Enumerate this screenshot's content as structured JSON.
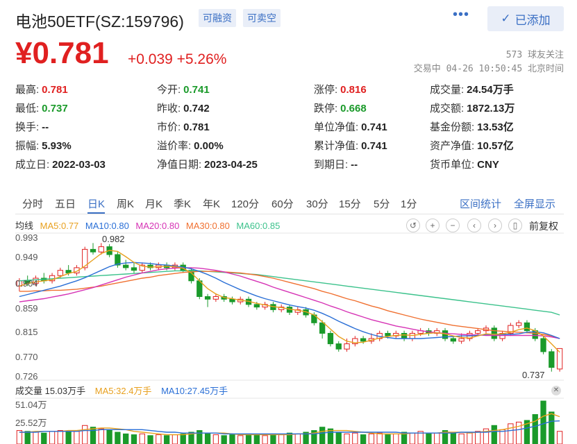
{
  "header": {
    "title": "电池50ETF(SZ:159796)",
    "tag_margin": "可融资",
    "tag_short": "可卖空",
    "more_icon": "more-dots-icon",
    "added_label": "已添加"
  },
  "quote": {
    "price": "¥0.781",
    "change": "+0.039 +5.26%",
    "followers": "573 球友关注",
    "status": "交易中 04-26 10:50:45 北京时间"
  },
  "stats": [
    [
      {
        "label": "最高:",
        "value": "0.781",
        "tone": "red"
      },
      {
        "label": "今开:",
        "value": "0.741",
        "tone": "green"
      },
      {
        "label": "涨停:",
        "value": "0.816",
        "tone": "red"
      },
      {
        "label": "成交量:",
        "value": "24.54万手",
        "tone": ""
      }
    ],
    [
      {
        "label": "最低:",
        "value": "0.737",
        "tone": "green"
      },
      {
        "label": "昨收:",
        "value": "0.742",
        "tone": ""
      },
      {
        "label": "跌停:",
        "value": "0.668",
        "tone": "green"
      },
      {
        "label": "成交额:",
        "value": "1872.13万",
        "tone": ""
      }
    ],
    [
      {
        "label": "换手:",
        "value": "--",
        "tone": ""
      },
      {
        "label": "市价:",
        "value": "0.781",
        "tone": ""
      },
      {
        "label": "单位净值:",
        "value": "0.741",
        "tone": ""
      },
      {
        "label": "基金份额:",
        "value": "13.53亿",
        "tone": ""
      }
    ],
    [
      {
        "label": "振幅:",
        "value": "5.93%",
        "tone": ""
      },
      {
        "label": "溢价率:",
        "value": "0.00%",
        "tone": ""
      },
      {
        "label": "累计净值:",
        "value": "0.741",
        "tone": ""
      },
      {
        "label": "资产净值:",
        "value": "10.57亿",
        "tone": ""
      }
    ],
    [
      {
        "label": "成立日:",
        "value": "2022-03-03",
        "tone": ""
      },
      {
        "label": "净值日期:",
        "value": "2023-04-25",
        "tone": ""
      },
      {
        "label": "到期日:",
        "value": "--",
        "tone": ""
      },
      {
        "label": "货币单位:",
        "value": "CNY",
        "tone": ""
      }
    ]
  ],
  "periods": [
    "分时",
    "五日",
    "日K",
    "周K",
    "月K",
    "季K",
    "年K",
    "120分",
    "60分",
    "30分",
    "15分",
    "5分",
    "1分"
  ],
  "active_period": "日K",
  "links": {
    "range_stats": "区间统计",
    "fullscreen": "全屏显示"
  },
  "chart_legend": {
    "prefix": "均线",
    "ma5": "MA5:0.77",
    "ma10": "MA10:0.80",
    "ma20": "MA20:0.80",
    "ma30": "MA30:0.80",
    "ma60": "MA60:0.85",
    "adjust": "前复权"
  },
  "colors": {
    "up": "#e02020",
    "down": "#1a9a2a",
    "ma5": "#e8a01e",
    "ma10": "#2a6fd6",
    "ma20": "#d633b5",
    "ma30": "#f07030",
    "ma60": "#3cc28c",
    "accent": "#3a6fc4"
  },
  "controls": [
    "undo-icon",
    "zoom-in-icon",
    "zoom-out-icon",
    "prev-icon",
    "next-icon",
    "candle-icon"
  ],
  "volume_legend": {
    "vol": "成交量 15.03万手",
    "ma5": "MA5:32.4万手",
    "ma10": "MA10:27.45万手"
  },
  "chart_data": {
    "type": "candlestick",
    "y_ticks": [
      "0.993",
      "0.949",
      "0.904",
      "0.859",
      "0.815",
      "0.770",
      "0.726"
    ],
    "ylim": [
      0.726,
      0.993
    ],
    "annotations": {
      "high": "0.982",
      "low": "0.737"
    },
    "vol_ticks": [
      "51.04万",
      "25.52万"
    ],
    "vol_max": 51.04,
    "candles": [
      [
        0.9,
        0.91,
        0.915,
        0.89
      ],
      [
        0.91,
        0.905,
        0.92,
        0.9
      ],
      [
        0.905,
        0.915,
        0.92,
        0.9
      ],
      [
        0.915,
        0.91,
        0.925,
        0.905
      ],
      [
        0.91,
        0.92,
        0.925,
        0.905
      ],
      [
        0.92,
        0.93,
        0.935,
        0.915
      ],
      [
        0.93,
        0.925,
        0.94,
        0.92
      ],
      [
        0.925,
        0.935,
        0.94,
        0.92
      ],
      [
        0.935,
        0.97,
        0.975,
        0.93
      ],
      [
        0.97,
        0.965,
        0.982,
        0.96
      ],
      [
        0.965,
        0.975,
        0.982,
        0.96
      ],
      [
        0.975,
        0.96,
        0.98,
        0.955
      ],
      [
        0.96,
        0.94,
        0.965,
        0.935
      ],
      [
        0.94,
        0.935,
        0.95,
        0.93
      ],
      [
        0.935,
        0.93,
        0.945,
        0.925
      ],
      [
        0.93,
        0.94,
        0.945,
        0.925
      ],
      [
        0.94,
        0.935,
        0.945,
        0.93
      ],
      [
        0.935,
        0.94,
        0.945,
        0.93
      ],
      [
        0.94,
        0.935,
        0.945,
        0.93
      ],
      [
        0.935,
        0.94,
        0.945,
        0.93
      ],
      [
        0.94,
        0.93,
        0.945,
        0.925
      ],
      [
        0.93,
        0.91,
        0.935,
        0.905
      ],
      [
        0.91,
        0.88,
        0.915,
        0.875
      ],
      [
        0.88,
        0.875,
        0.885,
        0.86
      ],
      [
        0.875,
        0.88,
        0.885,
        0.87
      ],
      [
        0.88,
        0.875,
        0.885,
        0.87
      ],
      [
        0.875,
        0.87,
        0.88,
        0.865
      ],
      [
        0.87,
        0.875,
        0.88,
        0.865
      ],
      [
        0.875,
        0.865,
        0.88,
        0.86
      ],
      [
        0.865,
        0.86,
        0.87,
        0.855
      ],
      [
        0.86,
        0.865,
        0.87,
        0.855
      ],
      [
        0.865,
        0.855,
        0.87,
        0.85
      ],
      [
        0.855,
        0.86,
        0.865,
        0.85
      ],
      [
        0.86,
        0.85,
        0.865,
        0.845
      ],
      [
        0.85,
        0.855,
        0.86,
        0.845
      ],
      [
        0.855,
        0.845,
        0.86,
        0.84
      ],
      [
        0.845,
        0.83,
        0.85,
        0.825
      ],
      [
        0.83,
        0.81,
        0.835,
        0.8
      ],
      [
        0.81,
        0.79,
        0.815,
        0.785
      ],
      [
        0.79,
        0.78,
        0.795,
        0.775
      ],
      [
        0.78,
        0.79,
        0.8,
        0.775
      ],
      [
        0.79,
        0.8,
        0.805,
        0.785
      ],
      [
        0.8,
        0.795,
        0.805,
        0.79
      ],
      [
        0.795,
        0.8,
        0.81,
        0.79
      ],
      [
        0.8,
        0.81,
        0.815,
        0.795
      ],
      [
        0.81,
        0.805,
        0.815,
        0.8
      ],
      [
        0.805,
        0.81,
        0.815,
        0.8
      ],
      [
        0.81,
        0.8,
        0.815,
        0.795
      ],
      [
        0.8,
        0.81,
        0.815,
        0.795
      ],
      [
        0.81,
        0.815,
        0.82,
        0.805
      ],
      [
        0.815,
        0.81,
        0.82,
        0.805
      ],
      [
        0.81,
        0.815,
        0.82,
        0.805
      ],
      [
        0.815,
        0.8,
        0.82,
        0.795
      ],
      [
        0.8,
        0.795,
        0.805,
        0.79
      ],
      [
        0.795,
        0.8,
        0.81,
        0.79
      ],
      [
        0.8,
        0.81,
        0.815,
        0.795
      ],
      [
        0.81,
        0.815,
        0.82,
        0.805
      ],
      [
        0.815,
        0.82,
        0.825,
        0.81
      ],
      [
        0.82,
        0.8,
        0.825,
        0.795
      ],
      [
        0.8,
        0.81,
        0.815,
        0.795
      ],
      [
        0.81,
        0.825,
        0.83,
        0.805
      ],
      [
        0.825,
        0.83,
        0.835,
        0.82
      ],
      [
        0.83,
        0.815,
        0.835,
        0.81
      ],
      [
        0.815,
        0.8,
        0.82,
        0.795
      ],
      [
        0.8,
        0.775,
        0.805,
        0.77
      ],
      [
        0.775,
        0.745,
        0.78,
        0.737
      ],
      [
        0.742,
        0.781,
        0.781,
        0.737
      ]
    ],
    "volume": [
      16,
      15,
      14,
      13,
      15,
      16,
      14,
      15,
      22,
      20,
      18,
      17,
      14,
      12,
      11,
      12,
      10,
      11,
      10,
      11,
      12,
      14,
      16,
      13,
      11,
      10,
      11,
      10,
      12,
      11,
      10,
      12,
      11,
      13,
      12,
      14,
      16,
      20,
      18,
      14,
      12,
      13,
      11,
      12,
      13,
      11,
      12,
      14,
      13,
      15,
      12,
      13,
      16,
      14,
      12,
      13,
      15,
      18,
      22,
      17,
      24,
      26,
      28,
      35,
      51,
      38,
      15.03
    ],
    "ma5": [
      0.9,
      0.905,
      0.908,
      0.91,
      0.912,
      0.918,
      0.924,
      0.928,
      0.938,
      0.95,
      0.962,
      0.968,
      0.966,
      0.956,
      0.945,
      0.938,
      0.936,
      0.937,
      0.938,
      0.937,
      0.934,
      0.925,
      0.91,
      0.895,
      0.885,
      0.878,
      0.876,
      0.873,
      0.871,
      0.867,
      0.864,
      0.861,
      0.859,
      0.856,
      0.854,
      0.851,
      0.845,
      0.832,
      0.818,
      0.804,
      0.795,
      0.792,
      0.793,
      0.797,
      0.801,
      0.804,
      0.806,
      0.807,
      0.806,
      0.808,
      0.81,
      0.811,
      0.809,
      0.805,
      0.802,
      0.801,
      0.805,
      0.809,
      0.808,
      0.809,
      0.812,
      0.817,
      0.82,
      0.815,
      0.805,
      0.79,
      0.774
    ],
    "ma10": [
      0.88,
      0.884,
      0.888,
      0.892,
      0.896,
      0.9,
      0.905,
      0.91,
      0.916,
      0.923,
      0.93,
      0.937,
      0.942,
      0.944,
      0.945,
      0.944,
      0.943,
      0.941,
      0.94,
      0.938,
      0.936,
      0.933,
      0.928,
      0.922,
      0.915,
      0.907,
      0.9,
      0.893,
      0.887,
      0.881,
      0.876,
      0.872,
      0.868,
      0.864,
      0.861,
      0.858,
      0.854,
      0.848,
      0.841,
      0.833,
      0.826,
      0.819,
      0.813,
      0.808,
      0.804,
      0.802,
      0.8,
      0.8,
      0.8,
      0.8,
      0.801,
      0.802,
      0.803,
      0.804,
      0.805,
      0.805,
      0.806,
      0.808,
      0.808,
      0.808,
      0.808,
      0.809,
      0.812,
      0.813,
      0.811,
      0.806,
      0.8
    ],
    "ma20": [
      0.87,
      0.872,
      0.874,
      0.876,
      0.879,
      0.882,
      0.885,
      0.889,
      0.893,
      0.897,
      0.902,
      0.907,
      0.912,
      0.917,
      0.921,
      0.925,
      0.928,
      0.931,
      0.933,
      0.934,
      0.935,
      0.935,
      0.934,
      0.932,
      0.93,
      0.927,
      0.923,
      0.919,
      0.914,
      0.909,
      0.904,
      0.898,
      0.893,
      0.888,
      0.883,
      0.878,
      0.873,
      0.868,
      0.862,
      0.857,
      0.851,
      0.846,
      0.841,
      0.836,
      0.832,
      0.828,
      0.824,
      0.821,
      0.818,
      0.815,
      0.813,
      0.811,
      0.81,
      0.809,
      0.808,
      0.807,
      0.807,
      0.806,
      0.806,
      0.806,
      0.806,
      0.806,
      0.806,
      0.806,
      0.805,
      0.803,
      0.8
    ],
    "ma30": [
      0.89,
      0.89,
      0.891,
      0.891,
      0.892,
      0.892,
      0.893,
      0.894,
      0.896,
      0.898,
      0.9,
      0.903,
      0.906,
      0.909,
      0.912,
      0.915,
      0.917,
      0.92,
      0.922,
      0.924,
      0.926,
      0.927,
      0.928,
      0.928,
      0.928,
      0.927,
      0.926,
      0.925,
      0.923,
      0.921,
      0.918,
      0.915,
      0.911,
      0.907,
      0.903,
      0.899,
      0.895,
      0.89,
      0.886,
      0.881,
      0.876,
      0.872,
      0.867,
      0.862,
      0.858,
      0.853,
      0.849,
      0.845,
      0.841,
      0.837,
      0.834,
      0.831,
      0.828,
      0.825,
      0.823,
      0.821,
      0.819,
      0.817,
      0.815,
      0.814,
      0.813,
      0.812,
      0.811,
      0.81,
      0.808,
      0.805,
      0.8
    ],
    "ma60": [
      0.91,
      0.911,
      0.912,
      0.913,
      0.914,
      0.915,
      0.916,
      0.917,
      0.918,
      0.919,
      0.92,
      0.921,
      0.922,
      0.923,
      0.924,
      0.925,
      0.926,
      0.927,
      0.928,
      0.929,
      0.929,
      0.929,
      0.929,
      0.928,
      0.927,
      0.926,
      0.925,
      0.924,
      0.923,
      0.922,
      0.92,
      0.918,
      0.916,
      0.914,
      0.912,
      0.91,
      0.908,
      0.906,
      0.904,
      0.902,
      0.9,
      0.898,
      0.896,
      0.894,
      0.892,
      0.89,
      0.888,
      0.886,
      0.884,
      0.882,
      0.88,
      0.878,
      0.876,
      0.874,
      0.872,
      0.87,
      0.868,
      0.866,
      0.864,
      0.862,
      0.86,
      0.858,
      0.856,
      0.854,
      0.852,
      0.85,
      0.845
    ],
    "vol_ma5": [
      14,
      14,
      15,
      15,
      15,
      15,
      16,
      16,
      17,
      18,
      19,
      19,
      18,
      17,
      15,
      14,
      13,
      12,
      11,
      11,
      11,
      12,
      13,
      13,
      13,
      13,
      12,
      11,
      11,
      11,
      11,
      11,
      11,
      11,
      12,
      12,
      13,
      15,
      16,
      16,
      16,
      15,
      14,
      13,
      12,
      12,
      12,
      12,
      13,
      13,
      13,
      13,
      14,
      14,
      14,
      13,
      14,
      15,
      16,
      17,
      19,
      21,
      24,
      27,
      33,
      36,
      32.4
    ],
    "vol_ma10": [
      14,
      14,
      14,
      15,
      15,
      15,
      15,
      15,
      16,
      16,
      17,
      17,
      17,
      17,
      17,
      17,
      16,
      15,
      14,
      14,
      13,
      13,
      13,
      13,
      13,
      12,
      12,
      12,
      12,
      12,
      12,
      12,
      12,
      12,
      12,
      12,
      12,
      13,
      14,
      14,
      14,
      14,
      14,
      14,
      14,
      14,
      14,
      13,
      13,
      13,
      13,
      13,
      13,
      13,
      14,
      14,
      14,
      14,
      15,
      15,
      16,
      17,
      19,
      21,
      24,
      27,
      27.45
    ]
  }
}
